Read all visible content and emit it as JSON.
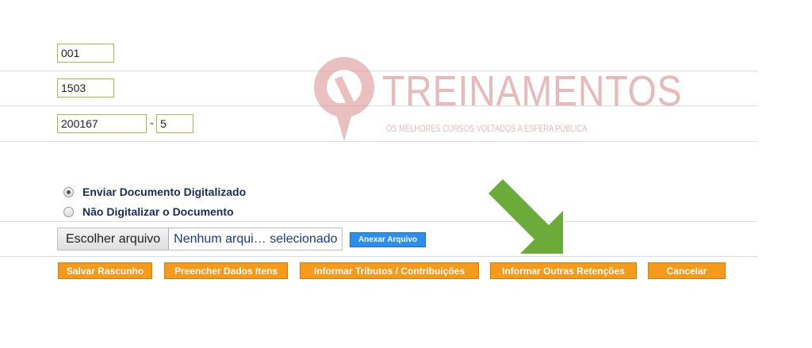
{
  "form": {
    "field1_value": "001",
    "field2_value": "1503",
    "field3_value": "200167",
    "field3_dash": "-",
    "field3_digit": "5"
  },
  "document": {
    "option_send": "Enviar Documento Digitalizado",
    "option_nodigit": "Não Digitalizar o Documento",
    "selected_option": "Enviar Documento Digitalizado",
    "file_button": "Escolher arquivo",
    "file_status": "Nenhum arqui… selecionado",
    "attach_button": "Anexar Arquivo"
  },
  "actions": {
    "save_draft": "Salvar Rascunho",
    "fill_items": "Preencher Dados Itens",
    "taxes": "Informar Tributos / Contribuições",
    "other_withholdings": "Informar Outras Retenções",
    "cancel": "Cancelar"
  },
  "watermark": {
    "brand": "TREINAMENTOS",
    "tagline": "OS MELHORES CURSOS VOLTADOS A ESFERA PÚBLICA"
  },
  "colors": {
    "field_border": "#a8b84a",
    "action_button": "#f59a1b",
    "attach_button": "#2b8ef0",
    "arrow": "#6aab3a",
    "watermark": "#d98b8b"
  }
}
